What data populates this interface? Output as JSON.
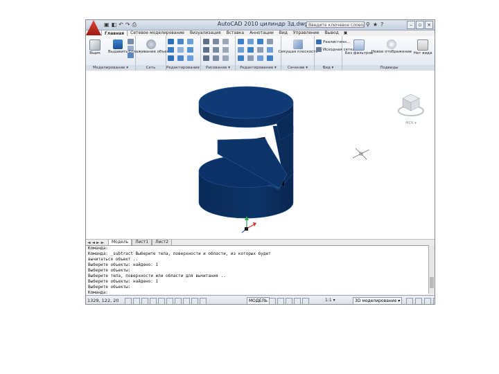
{
  "window": {
    "title": "AutoCAD 2010   цилиндр 3д.dwg",
    "search_placeholder": "Введите ключевое слово/фразу"
  },
  "quick_access": [
    "▣",
    "◧",
    "↶",
    "↷",
    "⎙"
  ],
  "title_icons": [
    "⚲",
    "★",
    "?"
  ],
  "window_controls": [
    "–",
    "▫",
    "×"
  ],
  "tabs": [
    "Главная",
    "Сетевое моделирование",
    "Визуализация",
    "Вставка",
    "Аннотации",
    "Вид",
    "Управление",
    "Вывод"
  ],
  "ribbon": {
    "panels": [
      {
        "name": "Моделирование ▾",
        "buttons": [
          "Ящик",
          "Выдавить"
        ]
      },
      {
        "name": "Сеть",
        "buttons": [
          "Сглаживание объекта"
        ]
      },
      {
        "name": "Редактирование ▾",
        "buttons": []
      },
      {
        "name": "Рисование ▾",
        "buttons": []
      },
      {
        "name": "Редактирование ▾",
        "buttons": []
      },
      {
        "name": "Сечение ▾",
        "buttons": [
          "Секущая плоскость"
        ]
      },
      {
        "name": "Вид ▾",
        "buttons": []
      },
      {
        "name": "Подвиды",
        "buttons": [
          "Без фильтров",
          "Новое отображение"
        ]
      }
    ],
    "view_dropdown_1": "Реалистичн...",
    "view_dropdown_2": "Исходная сетка",
    "viewport_label": "Нет вида"
  },
  "viewcube_label": "МСК ▾",
  "layout_nav": "◄ ◄ ► ►",
  "layout_tabs": [
    "Модель",
    "Лист1",
    "Лист2"
  ],
  "command_lines": [
    "Команда:",
    "Команда: _subtract Выберите тела, поверхности и области, из которых будет",
    "вычитаться объект ..",
    "Выберите объекты: найдено: 1",
    "Выберите объекты:",
    "Выберите тела, поверхности или области для вычитания ..",
    "Выберите объекты: найдено: 1",
    "Выберите объекты:",
    "Команда:"
  ],
  "status": {
    "coords": "1329, 122, 20",
    "model": "МОДЕЛЬ",
    "scale": "1:1 ▾",
    "workspace": "3D моделирование ▾"
  },
  "colors": {
    "solid_fill": "#0c2e5e",
    "solid_edge": "#1f4f8c",
    "ribbon_bg": "#e1e7ef"
  }
}
